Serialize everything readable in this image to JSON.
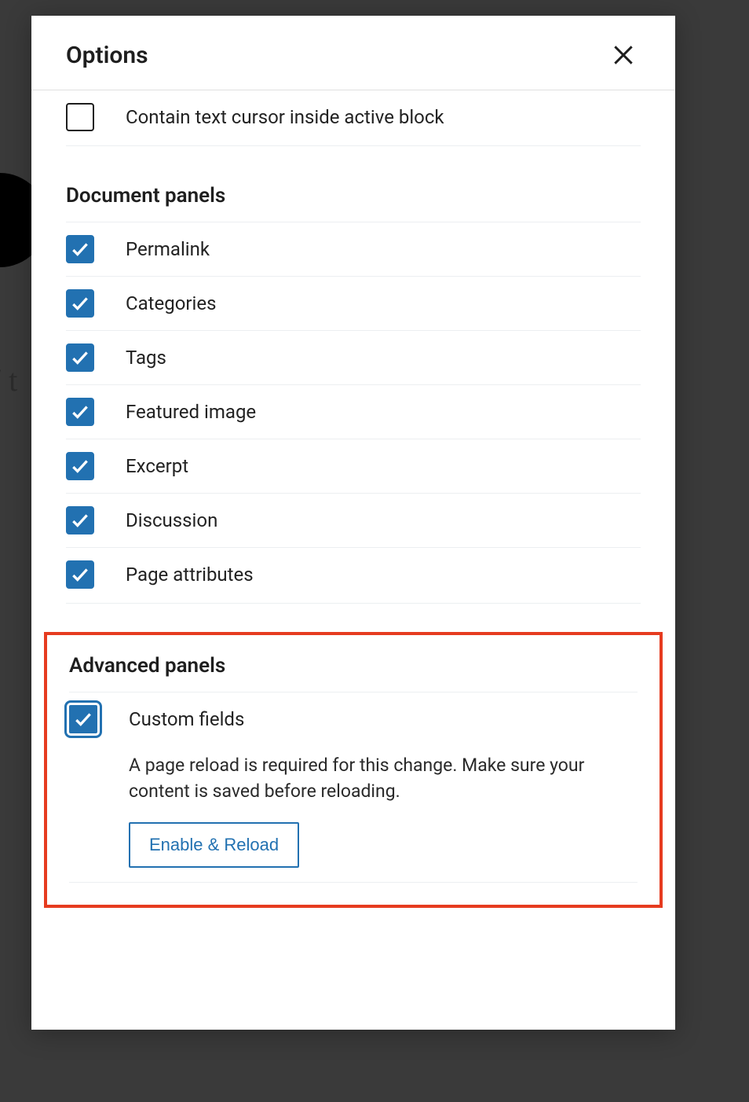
{
  "modal": {
    "title": "Options"
  },
  "top_option": {
    "label": "Contain text cursor inside active block",
    "checked": false
  },
  "document_panels": {
    "heading": "Document panels",
    "items": [
      {
        "label": "Permalink",
        "checked": true
      },
      {
        "label": "Categories",
        "checked": true
      },
      {
        "label": "Tags",
        "checked": true
      },
      {
        "label": "Featured image",
        "checked": true
      },
      {
        "label": "Excerpt",
        "checked": true
      },
      {
        "label": "Discussion",
        "checked": true
      },
      {
        "label": "Page attributes",
        "checked": true
      }
    ]
  },
  "advanced_panels": {
    "heading": "Advanced panels",
    "custom_fields": {
      "label": "Custom fields",
      "checked": true,
      "focused": true,
      "description": "A page reload is required for this change. Make sure your content is saved before reloading.",
      "button_label": "Enable & Reload"
    }
  },
  "bg_fragment": "/ t"
}
